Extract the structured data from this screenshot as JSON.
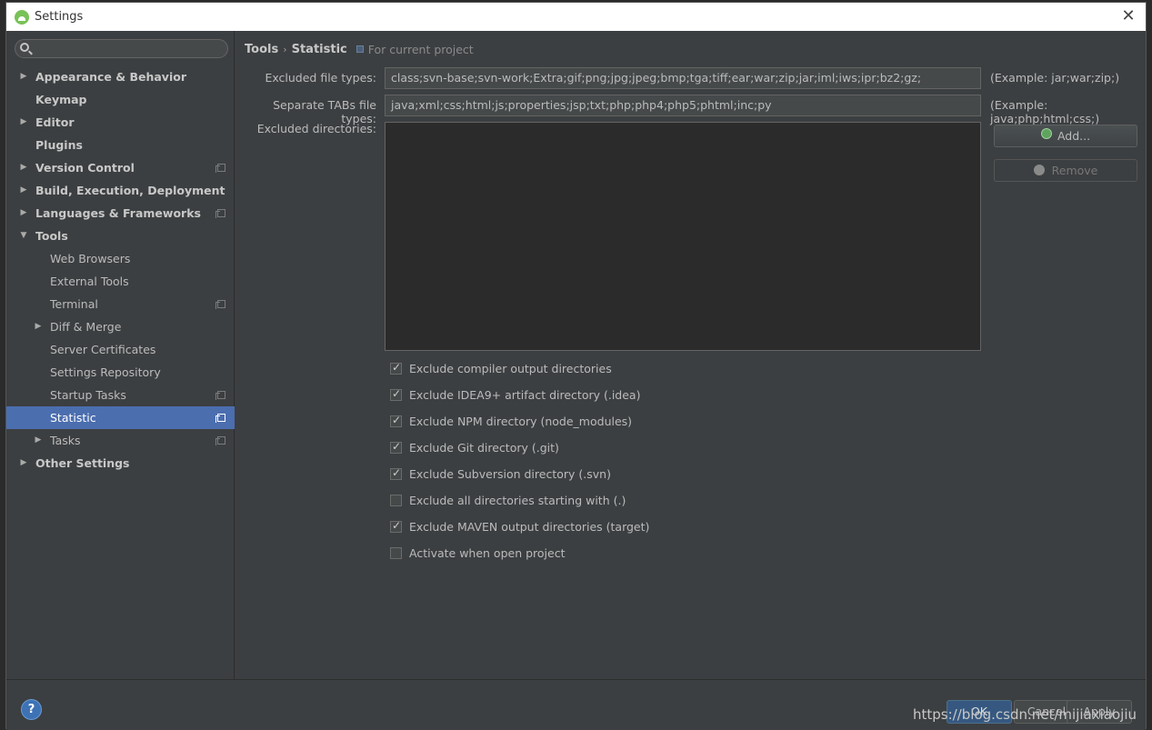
{
  "window": {
    "title": "Settings"
  },
  "search": {
    "placeholder": ""
  },
  "sidebar": {
    "items": [
      {
        "label": "Appearance & Behavior"
      },
      {
        "label": "Keymap"
      },
      {
        "label": "Editor"
      },
      {
        "label": "Plugins"
      },
      {
        "label": "Version Control"
      },
      {
        "label": "Build, Execution, Deployment"
      },
      {
        "label": "Languages & Frameworks"
      },
      {
        "label": "Tools"
      },
      {
        "label": "Web Browsers"
      },
      {
        "label": "External Tools"
      },
      {
        "label": "Terminal"
      },
      {
        "label": "Diff & Merge"
      },
      {
        "label": "Server Certificates"
      },
      {
        "label": "Settings Repository"
      },
      {
        "label": "Startup Tasks"
      },
      {
        "label": "Statistic"
      },
      {
        "label": "Tasks"
      },
      {
        "label": "Other Settings"
      }
    ]
  },
  "breadcrumb": {
    "parent": "Tools",
    "current": "Statistic",
    "scope": "For current project"
  },
  "form": {
    "excluded_types_label": "Excluded file types:",
    "excluded_types_value": "class;svn-base;svn-work;Extra;gif;png;jpg;jpeg;bmp;tga;tiff;ear;war;zip;jar;iml;iws;ipr;bz2;gz;",
    "excluded_types_example": "(Example: jar;war;zip;)",
    "tabs_types_label": "Separate TABs file types:",
    "tabs_types_value": "java;xml;css;html;js;properties;jsp;txt;php;php4;php5;phtml;inc;py",
    "tabs_types_example": "(Example: java;php;html;css;)",
    "excluded_dirs_label": "Excluded directories:",
    "add_label": "Add...",
    "remove_label": "Remove"
  },
  "checkboxes": [
    {
      "label": "Exclude compiler output directories",
      "checked": true
    },
    {
      "label": "Exclude IDEA9+ artifact directory (.idea)",
      "checked": true
    },
    {
      "label": "Exclude NPM directory (node_modules)",
      "checked": true
    },
    {
      "label": "Exclude Git directory (.git)",
      "checked": true
    },
    {
      "label": "Exclude Subversion directory (.svn)",
      "checked": true
    },
    {
      "label": "Exclude all directories starting with (.)",
      "checked": false
    },
    {
      "label": "Exclude MAVEN output directories (target)",
      "checked": true
    },
    {
      "label": "Activate when open project",
      "checked": false
    }
  ],
  "footer": {
    "help": "?",
    "ok_label": "OK",
    "cancel_label": "Cancel",
    "apply_label": "Apply"
  },
  "watermark": "https://blog.csdn.net/mijiaxiaojiu"
}
